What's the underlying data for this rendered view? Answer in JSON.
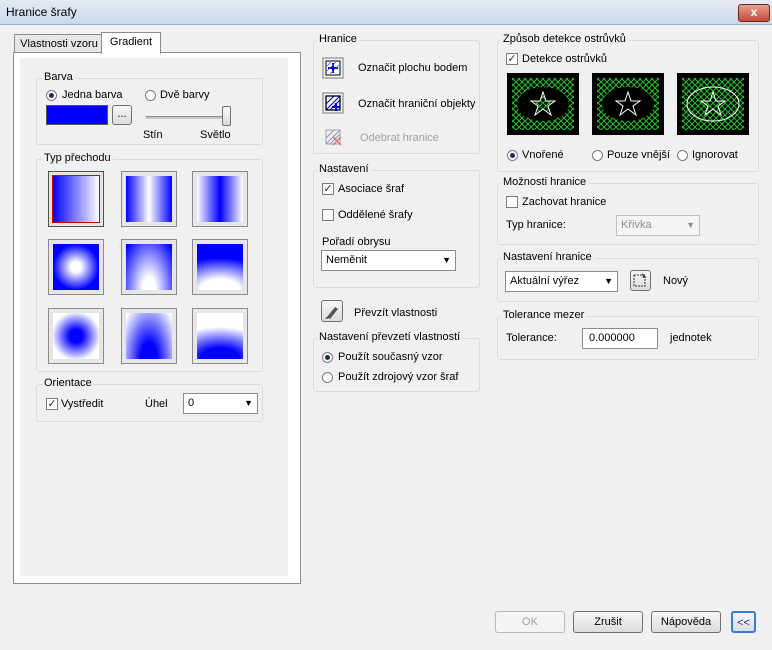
{
  "window": {
    "title": "Hranice šrafy",
    "close_glyph": "x"
  },
  "tabs": [
    {
      "label": "Vlastnosti vzoru"
    },
    {
      "label": "Gradient"
    }
  ],
  "gradient": {
    "color_group": {
      "label": "Barva",
      "one_color": "Jedna barva",
      "two_colors": "Dvě barvy",
      "swatch_color": "#0000ff",
      "browse_label": "...",
      "shade_label": "Stín",
      "tint_label": "Světlo",
      "slider_value": 1.0
    },
    "pattern_group": {
      "label": "Typ přechodu"
    },
    "orientation_group": {
      "label": "Orientace",
      "center_label": "Vystředit",
      "angle_label": "Úhel",
      "angle_value": "0"
    }
  },
  "boundaries": {
    "label": "Hranice",
    "pick_point": "Označit plochu bodem",
    "select_objects": "Označit hraniční objekty",
    "remove": "Odebrat hranice"
  },
  "options": {
    "label": "Nastavení",
    "associative": "Asociace šraf",
    "separate": "Oddělené šrafy",
    "draw_order_label": "Pořadí obrysu",
    "draw_order_value": "Neměnit"
  },
  "inherit": {
    "label": "Převzít vlastnosti"
  },
  "inherit_options": {
    "label": "Nastavení převzetí vlastností",
    "use_current": "Použít současný vzor",
    "use_source": "Použít zdrojový vzor šraf"
  },
  "islands": {
    "label": "Způsob detekce ostrůvků",
    "detect": "Detekce ostrůvků",
    "normal": "Vnořené",
    "outer": "Pouze vnější",
    "ignore": "Ignorovat"
  },
  "boundary_retention": {
    "label": "Možnosti hranice",
    "retain": "Zachovat hranice",
    "type_label": "Typ hranice:",
    "type_value": "Křivka"
  },
  "boundary_set": {
    "label": "Nastavení hranice",
    "value": "Aktuální výřez",
    "new_label": "Nový"
  },
  "gap": {
    "label": "Tolerance mezer",
    "tolerance_label": "Tolerance:",
    "tolerance_value": "0.000000",
    "units": "jednotek"
  },
  "footer": {
    "ok": "OK",
    "cancel": "Zrušit",
    "help": "Nápověda",
    "collapse": "<<"
  }
}
